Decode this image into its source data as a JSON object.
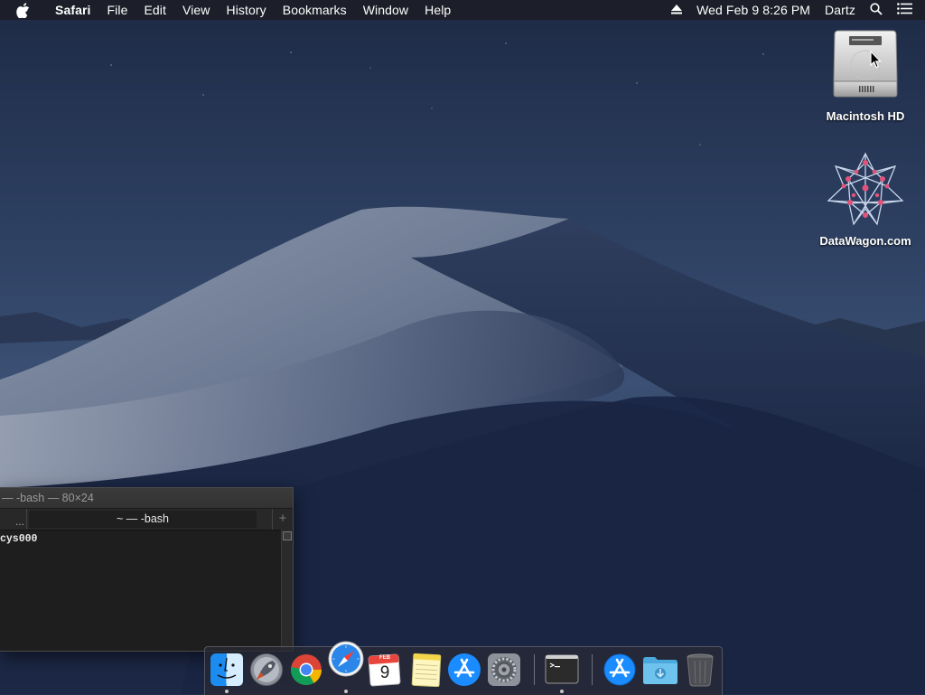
{
  "menubar": {
    "app_name": "Safari",
    "items": [
      "File",
      "Edit",
      "View",
      "History",
      "Bookmarks",
      "Window",
      "Help"
    ],
    "clock": "Wed Feb 9  8:26 PM",
    "user": "Dartz"
  },
  "desktop": {
    "icons": [
      {
        "label": "Macintosh HD",
        "icon": "hard-drive-icon"
      },
      {
        "label": "DataWagon.com",
        "icon": "network-star-icon"
      }
    ]
  },
  "terminal": {
    "title": "— -bash — 80×24",
    "tab_overflow": "...",
    "tab_label": "~ — -bash",
    "add_tab": "+",
    "output": "cys000"
  },
  "dock": {
    "apps": [
      {
        "name": "Finder",
        "icon": "finder-icon",
        "running": true
      },
      {
        "name": "Launchpad",
        "icon": "launchpad-icon",
        "running": false
      },
      {
        "name": "Google Chrome",
        "icon": "chrome-icon",
        "running": false
      },
      {
        "name": "Safari",
        "icon": "safari-icon",
        "running": true
      },
      {
        "name": "Calendar",
        "icon": "calendar-icon",
        "running": false,
        "month": "FEB",
        "day": "9"
      },
      {
        "name": "Notes",
        "icon": "notes-icon",
        "running": false
      },
      {
        "name": "App Store",
        "icon": "app-store-icon",
        "running": false
      },
      {
        "name": "System Preferences",
        "icon": "system-preferences-icon",
        "running": false
      },
      {
        "name": "Terminal",
        "icon": "terminal-icon",
        "running": true
      },
      {
        "name": "Applications",
        "icon": "applications-folder-icon",
        "running": false
      },
      {
        "name": "Downloads",
        "icon": "downloads-folder-icon",
        "running": false
      },
      {
        "name": "Trash",
        "icon": "trash-icon",
        "running": false
      }
    ]
  },
  "colors": {
    "menubar_bg": "#1c1e26",
    "wallpaper_sky": "#2b3c5c",
    "terminal_bg": "#1e1e1e",
    "accent_blue": "#1a8cff"
  }
}
